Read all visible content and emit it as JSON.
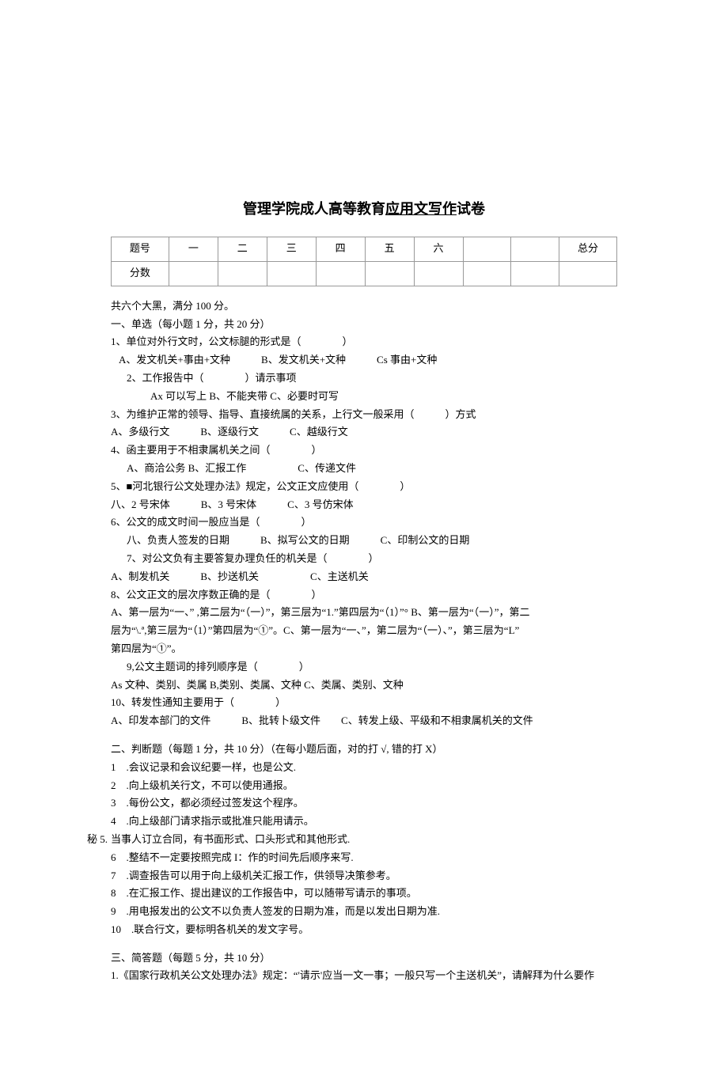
{
  "title_prefix": "管理学院成人高等教育",
  "title_underline": "应用文写作",
  "title_suffix": "试卷",
  "table": {
    "row1_label": "题号",
    "cols": [
      "一",
      "二",
      "三",
      "四",
      "五",
      "六",
      "",
      ""
    ],
    "total_label": "总分",
    "row2_label": "分数"
  },
  "intro": "共六个大黑，满分 100 分。",
  "section1_header": "一、单选（每小题 1 分，共 20 分）",
  "q1": "1、单位对外行文时，公文标腿的形式是（　　　　）",
  "q1_opts": "A、发文机关+事由+文种　　　B、发文机关+文种　　　Cs 事由+文种",
  "q2": "2、工作报告中（　　　　）请示事项",
  "q2_opts": "Ax 可以写上 B、不能夹带 C、必要时可写",
  "q3": "3、为维护正常的领导、指导、直接统属的关系，上行文一般采用（　　　）方式",
  "q3_opts": "A、多级行文　　　B、逐级行文　　　C、越级行文",
  "q4": "4、函主要用于不相隶属机关之间（　　　　）",
  "q4_opts": "A、商洽公务 B、汇报工作　　　　　C、传递文件",
  "q5": "5、■河北银行公文处理办法》规定，公文正文应使用（　　　　）",
  "q5_opts": "八、2 号宋体　　　B、3 号宋体　　　C、3 号仿宋体",
  "q6": "6、公文的成文时间一股应当是（　　　　）",
  "q6_opts": "八、负责人签发的日期　　　B、拟写公文的日期　　　C、印制公文的日期",
  "q7": "7、对公文负有主要答复办理负任的机关是（　　　　）",
  "q7_opts": "A、制发机关　　　B、抄送机关　　　　　C、主送机关",
  "q8": "8、公文正文的层次序数正确的是（　　　　）",
  "q8_opts1": "A、第一层为“一、” ,第二层为“（一）”，第三层为“1.”第四层为“（1）”° B、第一层为“（一）”，第二",
  "q8_opts2": "层为“\\.ª,第三层为“（1）”第四层为“①”。C、第一层为“一、”，第二层为“（一）、”，第三层为“L”",
  "q8_opts3": "第四层为“①”。",
  "q9": "9,公文主题词的排列顺序是（　　　　）",
  "q9_opts": "As 文种、类别、类属 B,类别、类属、文种 C、类属、类别、文种",
  "q10": "10、转发性通知主要用于（　　　　）",
  "q10_opts": "A、印发本部门的文件　　　B、批转卜级文件　　C、转发上级、平级和不相隶属机关的文件",
  "section2_header": "二、判断题（每题 1 分，共 10 分）（在每小题后面，对的打 √, 错的打 X）",
  "j1": "1　.会议记录和会议纪要一样，也是公文.",
  "j2": "2　.向上级机关行文，不可以使用通报。",
  "j3": "3　.每份公文，都必须经过签发这个程序。",
  "j4": "4　.向上级部门请求指示或批准只能用请示。",
  "j5_side": "秘 5.",
  "j5": "当事人订立合同，有书面形式、口头形式和其他形式.",
  "j6": "6　.整结不一定要按照完成 I：作的时间先后顺序来写.",
  "j7": "7　.调查报告可以用于向上级机关汇报工作，供领导决策参考。",
  "j8": "8　.在汇报工作、提出建议的工作报告中，可以随带写请示的事项。",
  "j9": "9　.用电报发出的公文不以负责人签发的日期为准，而是以发出日期为准.",
  "j10": "10　.联合行文，要标明各机关的发文字号。",
  "section3_header": "三、简答题（每题 5 分，共 10 分）",
  "s1": "1.《国家行政机关公文处理办法》规定：“'请示'应当一文一事；一般只写一个主送机关”，请解拜为什么要作"
}
